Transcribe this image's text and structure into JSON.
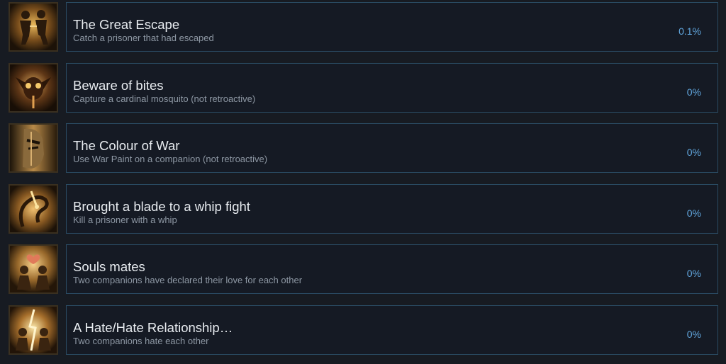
{
  "achievements": [
    {
      "title": "The Great Escape",
      "description": "Catch a prisoner that had escaped",
      "percent": "0.1%",
      "icon": "escaping-prisoners-icon"
    },
    {
      "title": "Beware of bites",
      "description": "Capture a cardinal mosquito (not retroactive)",
      "percent": "0%",
      "icon": "mosquito-icon"
    },
    {
      "title": "The Colour of War",
      "description": "Use War Paint on a companion (not retroactive)",
      "percent": "0%",
      "icon": "war-paint-face-icon"
    },
    {
      "title": "Brought a blade to a whip fight",
      "description": "Kill a prisoner with a whip",
      "percent": "0%",
      "icon": "whip-icon"
    },
    {
      "title": "Souls mates",
      "description": "Two companions have declared their love for each other",
      "percent": "0%",
      "icon": "lovers-heart-icon"
    },
    {
      "title": "A Hate/Hate Relationship…",
      "description": "Two companions hate each other",
      "percent": "0%",
      "icon": "rivals-lightning-icon"
    }
  ]
}
